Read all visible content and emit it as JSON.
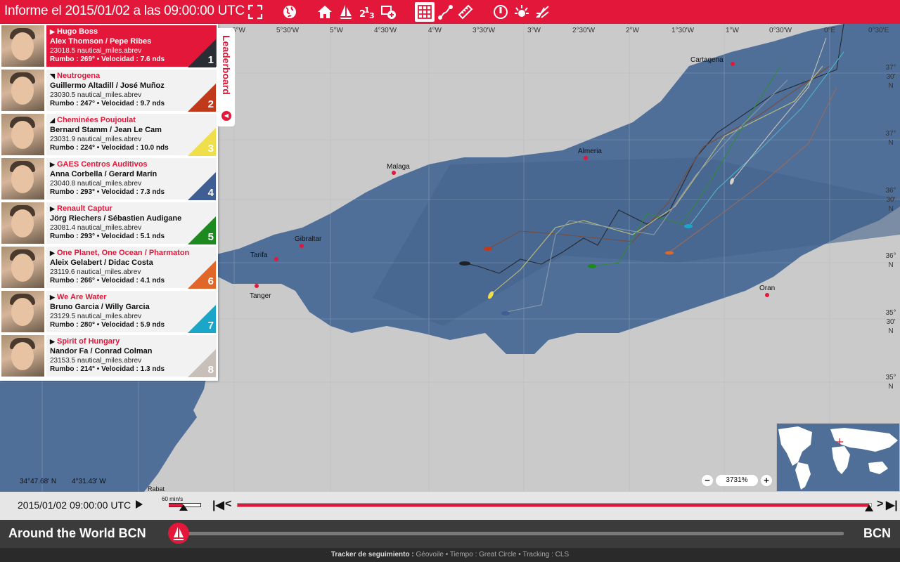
{
  "header": {
    "title": "Informe el 2015/01/02 a las 09:00:00 UTC",
    "icons": [
      "fullscreen-icon",
      "globe-icon",
      "home-icon",
      "sailboat-icon",
      "ranking-icon",
      "add-layer-icon",
      "grid-icon",
      "route-icon",
      "ruler-icon",
      "barometer-icon",
      "wind-icon",
      "sunset-icon"
    ]
  },
  "map": {
    "lon_labels": [
      "6°W",
      "5°30'W",
      "5°W",
      "4°30'W",
      "4°W",
      "3°30'W",
      "3°W",
      "2°30'W",
      "2°W",
      "1°30'W",
      "1°W",
      "0°30'W",
      "0°E",
      "0°30'E"
    ],
    "lat_labels": [
      {
        "lines": [
          "37°",
          "30'",
          "N"
        ]
      },
      {
        "lines": [
          "37°",
          "N"
        ]
      },
      {
        "lines": [
          "36°",
          "30'",
          "N"
        ]
      },
      {
        "lines": [
          "36°",
          "N"
        ]
      },
      {
        "lines": [
          "35°",
          "30'",
          "N"
        ]
      },
      {
        "lines": [
          "35°",
          "N"
        ]
      }
    ],
    "cities": [
      "Cartagena",
      "Almeria",
      "Malaga",
      "Gibraltar",
      "Tarifa",
      "Tanger",
      "Oran",
      "Rabat"
    ],
    "coords": {
      "lat": "34°47.68' N",
      "lon": "4°31.43' W"
    },
    "zoom": {
      "minus": "−",
      "value": "3731%",
      "plus": "+"
    }
  },
  "leaderboard": {
    "tab_label": "Leaderboard",
    "rows": [
      {
        "rank": "1",
        "boat": "Hugo Boss",
        "trend": "▶",
        "crew": "Alex Thomson / Pepe Ribes",
        "dist": "23018.5 nautical_miles.abrev",
        "speed": "Rumbo : 269° • Velocidad : 7.6 nds",
        "color": "#2b2d35"
      },
      {
        "rank": "2",
        "boat": "Neutrogena",
        "trend": "◥",
        "crew": "Guillermo Altadill / José Muñoz",
        "dist": "23030.5 nautical_miles.abrev",
        "speed": "Rumbo : 247° • Velocidad : 9.7 nds",
        "color": "#c0391b"
      },
      {
        "rank": "3",
        "boat": "Cheminées Poujoulat",
        "trend": "◢",
        "crew": "Bernard Stamm / Jean Le Cam",
        "dist": "23031.9 nautical_miles.abrev",
        "speed": "Rumbo : 224° • Velocidad : 10.0 nds",
        "color": "#efe04b"
      },
      {
        "rank": "4",
        "boat": "GAES Centros Auditivos",
        "trend": "▶",
        "crew": "Anna Corbella / Gerard Marín",
        "dist": "23040.8 nautical_miles.abrev",
        "speed": "Rumbo : 293° • Velocidad : 7.3 nds",
        "color": "#3f5f94"
      },
      {
        "rank": "5",
        "boat": "Renault Captur",
        "trend": "▶",
        "crew": "Jörg Riechers / Sébastien Audigane",
        "dist": "23081.4 nautical_miles.abrev",
        "speed": "Rumbo : 293° • Velocidad : 5.1 nds",
        "color": "#1c8a1f"
      },
      {
        "rank": "6",
        "boat": "One Planet, One Ocean / Pharmaton",
        "trend": "▶",
        "crew": "Aleix Gelabert / Didac Costa",
        "dist": "23119.6 nautical_miles.abrev",
        "speed": "Rumbo : 266° • Velocidad : 4.1 nds",
        "color": "#e0662a"
      },
      {
        "rank": "7",
        "boat": "We Are Water",
        "trend": "▶",
        "crew": "Bruno Garcia / Willy Garcia",
        "dist": "23129.5 nautical_miles.abrev",
        "speed": "Rumbo : 280° • Velocidad : 5.9 nds",
        "color": "#1aa6c8"
      },
      {
        "rank": "8",
        "boat": "Spirit of Hungary",
        "trend": "▶",
        "crew": "Nandor Fa / Conrad Colman",
        "dist": "23153.5 nautical_miles.abrev",
        "speed": "Rumbo : 214° • Velocidad : 1.3 nds",
        "color": "#c8c0b8"
      }
    ]
  },
  "timeline": {
    "date": "2015/01/02 09:00:00 UTC",
    "rate": "60 min/s",
    "rate_fraction": 0.4,
    "progress": 0.997
  },
  "race": {
    "name": "Around the World  BCN",
    "destination": "BCN"
  },
  "footer": {
    "label": "Tracker de seguimiento :",
    "text": " Géovoile • Tiempo : Great Circle • Tracking : CLS"
  }
}
